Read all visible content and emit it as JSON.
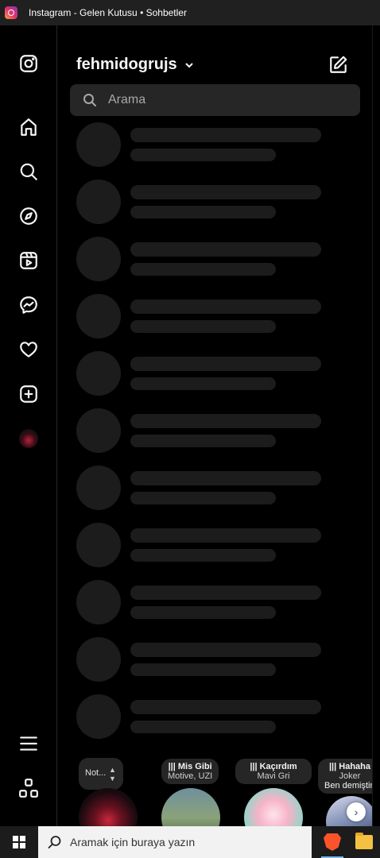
{
  "window": {
    "title": "Instagram - Gelen Kutusu • Sohbetler"
  },
  "nav": {
    "items": [
      "instagram-logo",
      "home",
      "search",
      "explore",
      "reels",
      "messages",
      "notifications",
      "create",
      "profile",
      "more",
      "apps"
    ]
  },
  "inbox": {
    "username": "fehmidogrujs",
    "search_placeholder": "Arama",
    "skeleton_rows": 11
  },
  "notes": [
    {
      "type": "self",
      "text": "Not..."
    },
    {
      "song": "Mis Gibi",
      "artist": "Motive, UZI"
    },
    {
      "song": "Kaçırdım",
      "artist": "Mavi Gri"
    },
    {
      "song": "Hahaha",
      "artist": "Joker",
      "extra": "Ben demiştim"
    }
  ],
  "taskbar": {
    "search_placeholder": "Aramak için buraya yazın"
  },
  "colors": {
    "background": "#000000",
    "skeleton": "#1c1c1c",
    "search_bg": "#262626",
    "accent_brave": "#fb542b"
  }
}
